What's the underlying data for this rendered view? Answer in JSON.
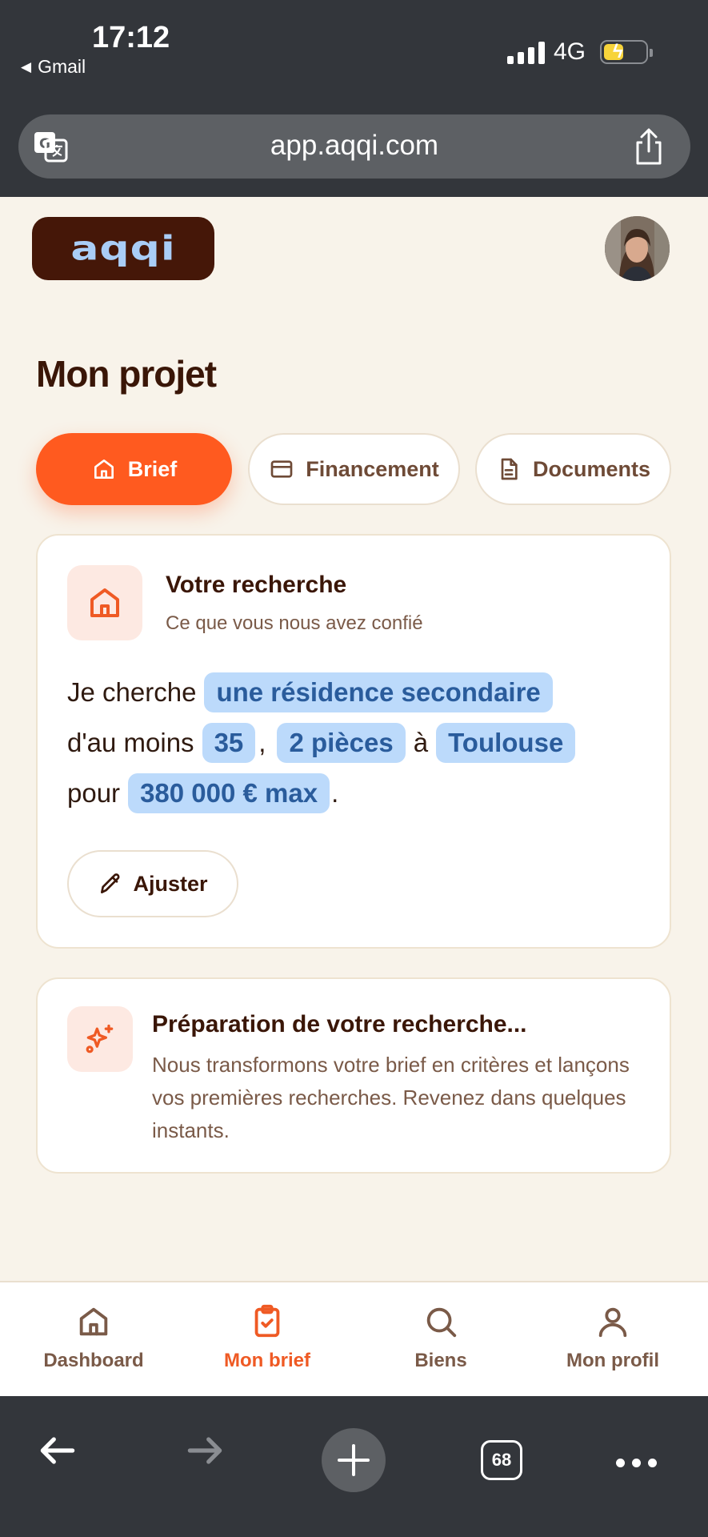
{
  "status_bar": {
    "time": "17:12",
    "back_app": "Gmail",
    "network": "4G"
  },
  "browser": {
    "url": "app.aqqi.com",
    "tabs_count": "68"
  },
  "app": {
    "logo_text": "aqqi"
  },
  "page": {
    "title": "Mon projet",
    "tabs": [
      {
        "label": "Brief",
        "icon": "home-icon",
        "active": true
      },
      {
        "label": "Financement",
        "icon": "credit-card-icon",
        "active": false
      },
      {
        "label": "Documents",
        "icon": "document-icon",
        "active": false
      }
    ]
  },
  "search_card": {
    "title": "Votre recherche",
    "subtitle": "Ce que vous nous avez confié",
    "text_1": "Je cherche",
    "property_type": "une résidence secondaire",
    "text_2": "d'au moins",
    "surface": "35",
    "comma": ",",
    "rooms": "2 pièces",
    "text_3": "à",
    "city": "Toulouse",
    "text_4": "pour",
    "budget": "380 000 € max",
    "period": ".",
    "adjust_label": "Ajuster"
  },
  "prep_card": {
    "title": "Préparation de votre recherche...",
    "body": "Nous transformons votre brief en critères et lançons vos premières recherches. Revenez dans quelques instants."
  },
  "bottom_nav": [
    {
      "label": "Dashboard",
      "icon": "home-icon",
      "active": false
    },
    {
      "label": "Mon brief",
      "icon": "clipboard-check-icon",
      "active": true
    },
    {
      "label": "Biens",
      "icon": "search-icon",
      "active": false
    },
    {
      "label": "Mon profil",
      "icon": "user-icon",
      "active": false
    }
  ],
  "colors": {
    "accent": "#ff5a1f",
    "brown": "#3a1607",
    "chip_bg": "#bcdafb",
    "chip_text": "#2a5c9c",
    "background": "#f8f3ea"
  }
}
